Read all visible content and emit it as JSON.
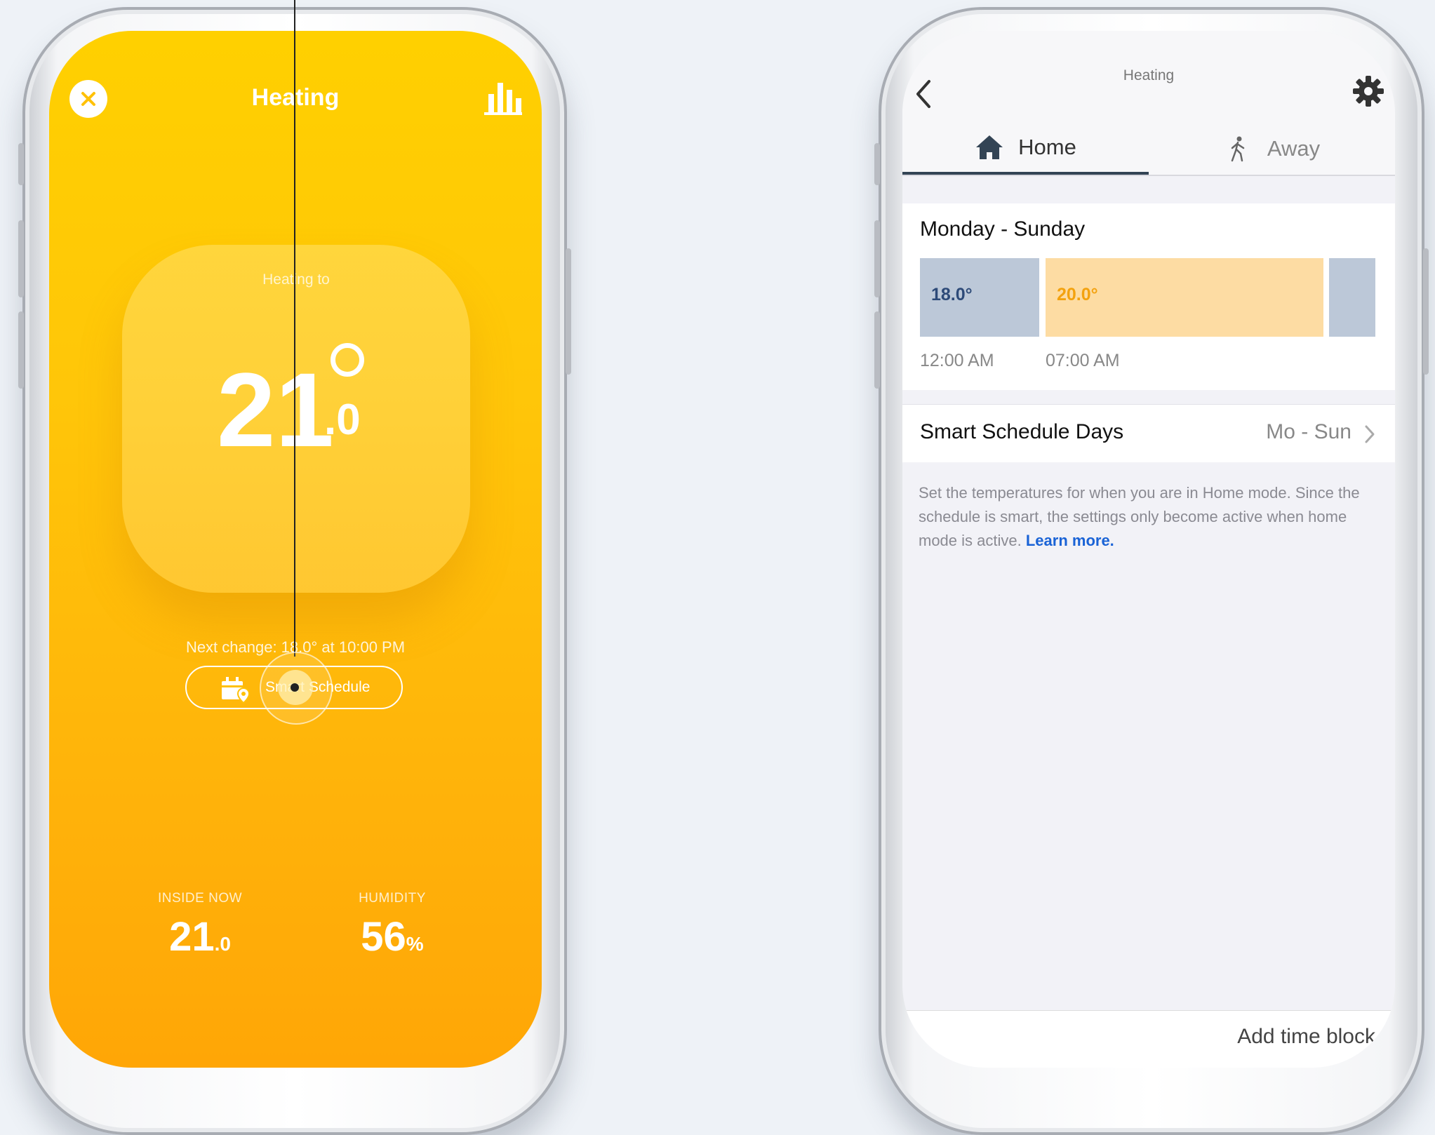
{
  "left_screen": {
    "title": "Heating",
    "heating_to_label": "Heating to",
    "target_temp": "21",
    "target_decimal": ".0",
    "next_change": "Next change: 18.0° at 10:00 PM",
    "schedule_button": "Smart Schedule",
    "inside_now_label": "INSIDE NOW",
    "inside_now_value": "21",
    "inside_now_decimal": ".0",
    "humidity_label": "HUMIDITY",
    "humidity_value": "56",
    "humidity_unit": "%",
    "icons": [
      "close-icon",
      "stats-icon",
      "calendar-location-icon"
    ],
    "accent_color": "#ffc107"
  },
  "right_screen": {
    "title": "Heating",
    "tabs": [
      {
        "label": "Home",
        "icon": "home-icon",
        "active": true
      },
      {
        "label": "Away",
        "icon": "walking-person-icon",
        "active": false
      }
    ],
    "schedule_days": "Monday - Sunday",
    "blocks": [
      {
        "temp": "18.0°",
        "time": "12:00 AM",
        "color": "#bcc8d8"
      },
      {
        "temp": "20.0°",
        "time": "07:00 AM",
        "color": "#fddca3"
      },
      {
        "temp": "",
        "time": "",
        "color": "#bcc8d8"
      }
    ],
    "smart_days_label": "Smart Schedule Days",
    "smart_days_value": "Mo - Sun",
    "description": "Set the temperatures for when you are in Home mode. Since the schedule is smart, the settings only become active when home mode is active.",
    "learn_more": "Learn more.",
    "add_block": "Add time block",
    "icons": [
      "back-icon",
      "gear-icon",
      "chevron-right-icon"
    ]
  }
}
